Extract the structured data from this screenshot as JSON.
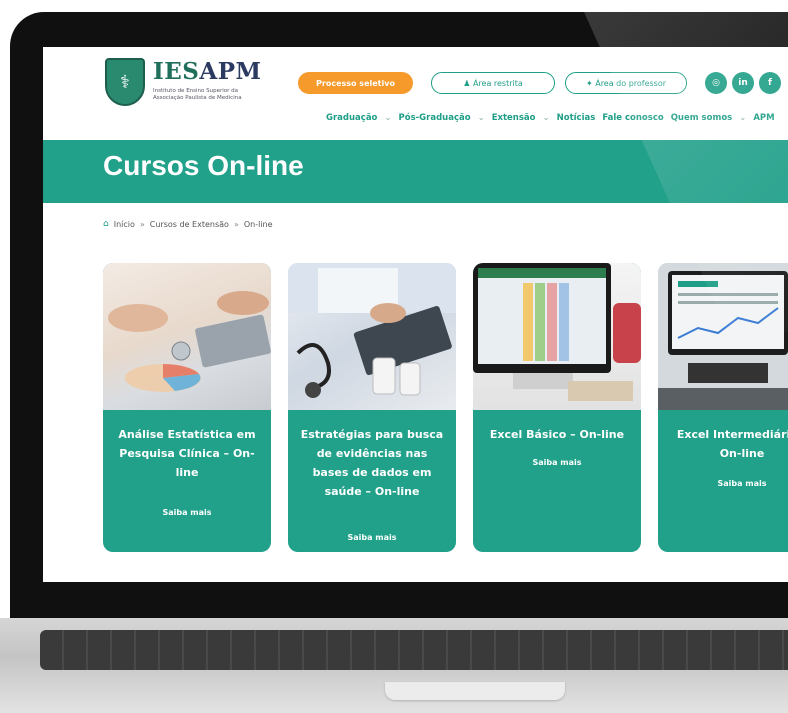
{
  "header": {
    "brand_a": "IES",
    "brand_b": "APM",
    "tagline": "Instituto de Ensino Superior da Associação Paulista de Medicina",
    "buttons": {
      "processo": "Processo seletivo",
      "restrita": "Área restrita",
      "professor": "Área do professor"
    },
    "social": [
      "◎",
      "in",
      "f"
    ]
  },
  "nav": {
    "items": [
      "Graduação",
      "Pós-Graduação",
      "Extensão",
      "Notícias",
      "Fale conosco",
      "Quem somos",
      "APM"
    ]
  },
  "hero": {
    "title": "Cursos On-line"
  },
  "breadcrumb": {
    "home": "Início",
    "item1": "Cursos de Extensão",
    "item2": "On-line"
  },
  "cards": [
    {
      "title": "Análise Estatística em Pesquisa Clínica – On-line",
      "link": "Saiba mais"
    },
    {
      "title": "Estratégias para busca de evidências nas bases de dados em saúde – On-line",
      "link": "Saiba mais"
    },
    {
      "title": "Excel Básico – On-line",
      "link": "Saiba mais"
    },
    {
      "title": "Excel Intermediário – On-line",
      "link": "Saiba mais"
    }
  ],
  "colors": {
    "accent": "#21a08a",
    "orange": "#f59a2b",
    "dark": "#101010"
  }
}
